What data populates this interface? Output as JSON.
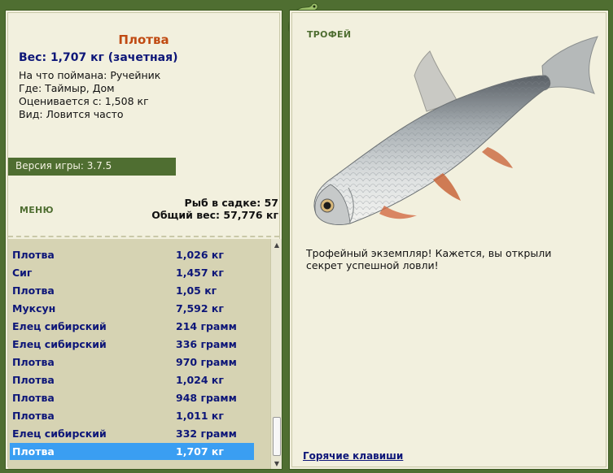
{
  "fish": {
    "name": "Плотва",
    "weight_line": "Вес: 1,707 кг (зачетная)",
    "bait_line": "На что поймана: Ручейник",
    "location_line": "Где: Таймыр, Дом",
    "valued_line": "Оценивается с: 1,508 кг",
    "kind_line": "Вид: Ловится часто"
  },
  "version": "Версия игры: 3.7.5",
  "menu_label": "МЕНЮ",
  "stats": {
    "fish_count": "Рыб в садке: 57",
    "total_weight": "Общий вес: 57,776 кг"
  },
  "catch_list": [
    {
      "name": "Плотва",
      "weight": "1,026 кг"
    },
    {
      "name": "Сиг",
      "weight": "1,457 кг"
    },
    {
      "name": "Плотва",
      "weight": "1,05 кг"
    },
    {
      "name": "Муксун",
      "weight": "7,592 кг"
    },
    {
      "name": "Елец сибирский",
      "weight": "214 грамм"
    },
    {
      "name": "Елец сибирский",
      "weight": "336 грамм"
    },
    {
      "name": "Плотва",
      "weight": "970 грамм"
    },
    {
      "name": "Плотва",
      "weight": "1,024 кг"
    },
    {
      "name": "Плотва",
      "weight": "948 грамм"
    },
    {
      "name": "Плотва",
      "weight": "1,011 кг"
    },
    {
      "name": "Елец сибирский",
      "weight": "332 грамм"
    },
    {
      "name": "Плотва",
      "weight": "1,707 кг",
      "selected": true
    }
  ],
  "trophy": {
    "title": "ТРОФЕЙ",
    "text": "Трофейный экземпляр! Кажется, вы открыли секрет успешной ловли!"
  },
  "hotkeys_label": "Горячие клавиши",
  "colors": {
    "frame_green": "#4f6e31",
    "panel_bg": "#f2f0de",
    "list_bg": "#d6d3b3",
    "accent_orange": "#c04a12",
    "text_blue": "#0d1678",
    "selection_blue": "#3a9ef2"
  },
  "icons": {
    "ornament": "lizard-ornament-icon",
    "fish_picture": "roach-fish-icon",
    "scroll_up": "chevron-up-icon",
    "scroll_down": "chevron-down-icon"
  }
}
